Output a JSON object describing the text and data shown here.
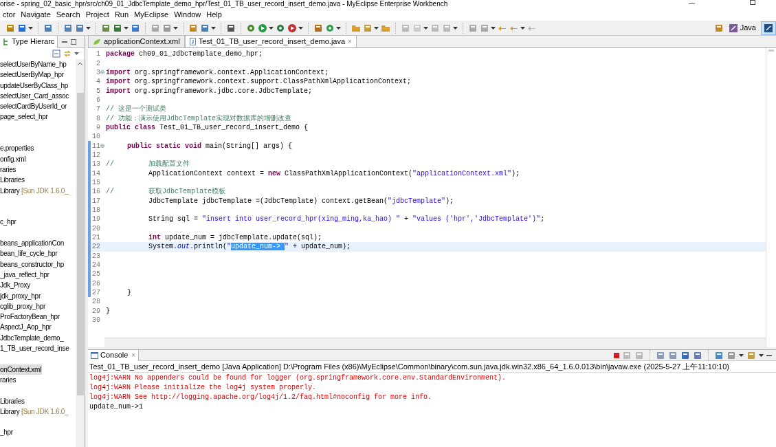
{
  "window": {
    "title": "orise - spring_02_basic_hpr/src/ch09_01_JdbcTemplate_demo_hpr/Test_01_TB_user_record_insert_demo.java - MyEclipse Enterprise Workbench"
  },
  "menu": [
    "ctor",
    "Navigate",
    "Search",
    "Project",
    "Run",
    "MyEclipse",
    "Window",
    "Help"
  ],
  "perspectives": [
    {
      "label": "Java",
      "selected": false
    },
    {
      "selected": true
    }
  ],
  "left_panel": {
    "tab": "Type Hierarc",
    "tree": [
      {
        "kind": "item",
        "label": "selectUserByName_hp",
        "selected": false
      },
      {
        "kind": "item",
        "label": "selectUserByMap_hpr",
        "selected": false
      },
      {
        "kind": "item",
        "label": "updateUserByClass_hp",
        "selected": false
      },
      {
        "kind": "item",
        "label": "selectUser_Card_assoc",
        "selected": false
      },
      {
        "kind": "item",
        "label": "selectCardByUserId_or",
        "selected": false
      },
      {
        "kind": "item",
        "label": "page_select_hpr",
        "selected": false
      },
      {
        "kind": "hidden"
      },
      {
        "kind": "hidden"
      },
      {
        "kind": "item",
        "label": "e.properties",
        "selected": false
      },
      {
        "kind": "item",
        "label": "onfig.xml",
        "selected": false
      },
      {
        "kind": "item",
        "label": "raries",
        "selected": false
      },
      {
        "kind": "item",
        "label": "Libraries",
        "selected": false
      },
      {
        "kind": "item",
        "label": "Library",
        "decoration": "[Sun JDK 1.6.0_",
        "selected": false
      },
      {
        "kind": "hidden"
      },
      {
        "kind": "hidden"
      },
      {
        "kind": "item",
        "label": "c_hpr",
        "selected": false
      },
      {
        "kind": "hidden"
      },
      {
        "kind": "item",
        "label": "beans_applicationCon",
        "selected": false
      },
      {
        "kind": "item",
        "label": "bean_life_cycle_hpr",
        "selected": false
      },
      {
        "kind": "item",
        "label": "beans_constructor_hp",
        "selected": false
      },
      {
        "kind": "item",
        "label": "_java_reflect_hpr",
        "selected": false
      },
      {
        "kind": "item",
        "label": "Jdk_Proxy",
        "selected": false
      },
      {
        "kind": "item",
        "label": "jdk_proxy_hpr",
        "selected": false
      },
      {
        "kind": "item",
        "label": "cglib_proxy_hpr",
        "selected": false
      },
      {
        "kind": "item",
        "label": "ProFactoryBean_hpr",
        "selected": false
      },
      {
        "kind": "item",
        "label": "AspectJ_Aop_hpr",
        "selected": false
      },
      {
        "kind": "item",
        "label": "JdbcTemplate_demo_",
        "selected": false
      },
      {
        "kind": "item",
        "label": "1_TB_user_record_inse",
        "selected": false
      },
      {
        "kind": "hidden"
      },
      {
        "kind": "item",
        "label": "onContext.xml",
        "selected": true
      },
      {
        "kind": "item",
        "label": "raries",
        "selected": false
      },
      {
        "kind": "hidden"
      },
      {
        "kind": "item",
        "label": "Libraries",
        "selected": false
      },
      {
        "kind": "item",
        "label": "Library",
        "decoration": "[Sun JDK 1.6.0_",
        "selected": false
      },
      {
        "kind": "hidden"
      },
      {
        "kind": "item",
        "label": "_hpr",
        "selected": false
      }
    ]
  },
  "editor": {
    "tabs": [
      {
        "label": "applicationContext.xml",
        "kind": "xml",
        "selected": false
      },
      {
        "label": "Test_01_TB_user_record_insert_demo.java",
        "kind": "java",
        "selected": true,
        "close": "×"
      }
    ],
    "lines": [
      {
        "number": "1",
        "fold": false,
        "changed": false,
        "current": false,
        "segments": [
          {
            "kind": "keyword",
            "text": "package"
          },
          {
            "kind": "plain",
            "text": " ch09_01_JdbcTemplate_demo_hpr;"
          }
        ]
      },
      {
        "number": "2",
        "fold": false,
        "changed": false,
        "current": false
      },
      {
        "number": "3",
        "fold": true,
        "changed": false,
        "current": false,
        "segments": [
          {
            "kind": "keyword",
            "text": "import"
          },
          {
            "kind": "plain",
            "text": " org.springframework.context.ApplicationContext;"
          }
        ]
      },
      {
        "number": "4",
        "fold": false,
        "changed": false,
        "current": false,
        "segments": [
          {
            "kind": "keyword",
            "text": "import"
          },
          {
            "kind": "plain",
            "text": " org.springframework.context.support.ClassPathXmlApplicationContext;"
          }
        ]
      },
      {
        "number": "5",
        "fold": false,
        "changed": false,
        "current": false,
        "segments": [
          {
            "kind": "keyword",
            "text": "import"
          },
          {
            "kind": "plain",
            "text": " org.springframework.jdbc.core.JdbcTemplate;"
          }
        ]
      },
      {
        "number": "6",
        "fold": false,
        "changed": false,
        "current": false
      },
      {
        "number": "7",
        "fold": false,
        "changed": false,
        "current": false,
        "segments": [
          {
            "kind": "comment",
            "text": "// 这是一个测试类"
          }
        ]
      },
      {
        "number": "8",
        "fold": false,
        "changed": false,
        "current": false,
        "segments": [
          {
            "kind": "comment",
            "text": "// 功能：演示使用JdbcTemplate实现对数据库的增删改查"
          }
        ]
      },
      {
        "number": "9",
        "fold": false,
        "changed": false,
        "current": false,
        "segments": [
          {
            "kind": "keyword",
            "text": "public class"
          },
          {
            "kind": "plain",
            "text": " Test_01_TB_user_record_insert_demo {"
          }
        ]
      },
      {
        "number": "10",
        "fold": false,
        "changed": false,
        "current": false
      },
      {
        "number": "11",
        "fold": true,
        "changed": true,
        "current": false,
        "segments": [
          {
            "kind": "keyword",
            "text": "\tpublic static void"
          },
          {
            "kind": "plain",
            "text": " main(String[] args) {"
          }
        ]
      },
      {
        "number": "12",
        "fold": false,
        "changed": true,
        "current": false
      },
      {
        "number": "13",
        "fold": false,
        "changed": true,
        "current": false,
        "segments": [
          {
            "kind": "comment",
            "text": "//\t\t加载配置文件"
          }
        ]
      },
      {
        "number": "14",
        "fold": false,
        "changed": true,
        "current": false,
        "segments": [
          {
            "kind": "plain",
            "text": "\t\tApplicationContext context ="
          },
          {
            "kind": "keyword",
            "text": " new"
          },
          {
            "kind": "plain",
            "text": " ClassPathXmlApplicationContext("
          },
          {
            "kind": "string",
            "text": "\"applicationContext.xml\""
          },
          {
            "kind": "plain",
            "text": ");"
          }
        ]
      },
      {
        "number": "15",
        "fold": false,
        "changed": true,
        "current": false
      },
      {
        "number": "16",
        "fold": false,
        "changed": true,
        "current": false,
        "segments": [
          {
            "kind": "comment",
            "text": "//\t\t获取JdbcTemplate模板"
          }
        ]
      },
      {
        "number": "17",
        "fold": false,
        "changed": true,
        "current": false,
        "segments": [
          {
            "kind": "plain",
            "text": "\t\tJdbcTemplate jdbcTemplate =(JdbcTemplate) context.getBean("
          },
          {
            "kind": "string",
            "text": "\"jdbcTemplate\""
          },
          {
            "kind": "plain",
            "text": ");"
          }
        ]
      },
      {
        "number": "18",
        "fold": false,
        "changed": true,
        "current": false
      },
      {
        "number": "19",
        "fold": false,
        "changed": true,
        "current": false,
        "segments": [
          {
            "kind": "plain",
            "text": "\t\tString sql ="
          },
          {
            "kind": "string",
            "text": " \"insert into user_record_hpr(xing_ming,ka_hao) \""
          },
          {
            "kind": "plain",
            "text": " +"
          },
          {
            "kind": "string",
            "text": " \"values ('hpr','JdbcTemplate')\""
          },
          {
            "kind": "plain",
            "text": ";"
          }
        ]
      },
      {
        "number": "20",
        "fold": false,
        "changed": true,
        "current": false
      },
      {
        "number": "21",
        "fold": false,
        "changed": true,
        "current": false,
        "segments": [
          {
            "kind": "keyword",
            "text": "\t\tint"
          },
          {
            "kind": "plain",
            "text": " update_num = jdbcTemplate.update(sql);"
          }
        ]
      },
      {
        "number": "22",
        "fold": false,
        "changed": true,
        "current": true,
        "segments": [
          {
            "kind": "plain",
            "text": "\t\tSystem."
          },
          {
            "kind": "field",
            "text": "out"
          },
          {
            "kind": "plain",
            "text": ".println("
          },
          {
            "kind": "string",
            "text": "\""
          },
          {
            "kind": "selection",
            "text": "update_num-> "
          },
          {
            "kind": "string",
            "text": "\""
          },
          {
            "kind": "plain",
            "text": " + update_num);"
          }
        ]
      },
      {
        "number": "23",
        "fold": false,
        "changed": true,
        "current": false
      },
      {
        "number": "24",
        "fold": false,
        "changed": true,
        "current": false
      },
      {
        "number": "25",
        "fold": false,
        "changed": true,
        "current": false
      },
      {
        "number": "26",
        "fold": false,
        "changed": true,
        "current": false
      },
      {
        "number": "27",
        "fold": false,
        "changed": true,
        "current": false,
        "segments": [
          {
            "kind": "plain",
            "text": "\t}"
          }
        ]
      },
      {
        "number": "28",
        "fold": false,
        "changed": false,
        "current": false
      },
      {
        "number": "29",
        "fold": false,
        "changed": false,
        "current": false,
        "segments": [
          {
            "kind": "plain",
            "text": "}"
          }
        ]
      },
      {
        "number": "30",
        "fold": false,
        "changed": false,
        "current": false
      }
    ]
  },
  "console": {
    "tab": "Console",
    "close": "×",
    "header": "Test_01_TB_user_record_insert_demo [Java Application] D:\\Program Files (x86)\\MyEclipse\\Common\\binary\\com.sun.java.jdk.win32.x86_64_1.6.0.013\\bin\\javaw.exe (2025-5-27 上午11:10:10)",
    "lines": [
      {
        "kind": "err",
        "text": "log4j:WARN No appenders could be found for logger (org.springframework.core.env.StandardEnvironment)."
      },
      {
        "kind": "err",
        "text": "log4j:WARN Please initialize the log4j system properly."
      },
      {
        "kind": "err",
        "text": "log4j:WARN See http://logging.apache.org/log4j/1.2/faq.html#noconfig for more info."
      },
      {
        "kind": "out",
        "text": "update_num->1"
      }
    ]
  }
}
